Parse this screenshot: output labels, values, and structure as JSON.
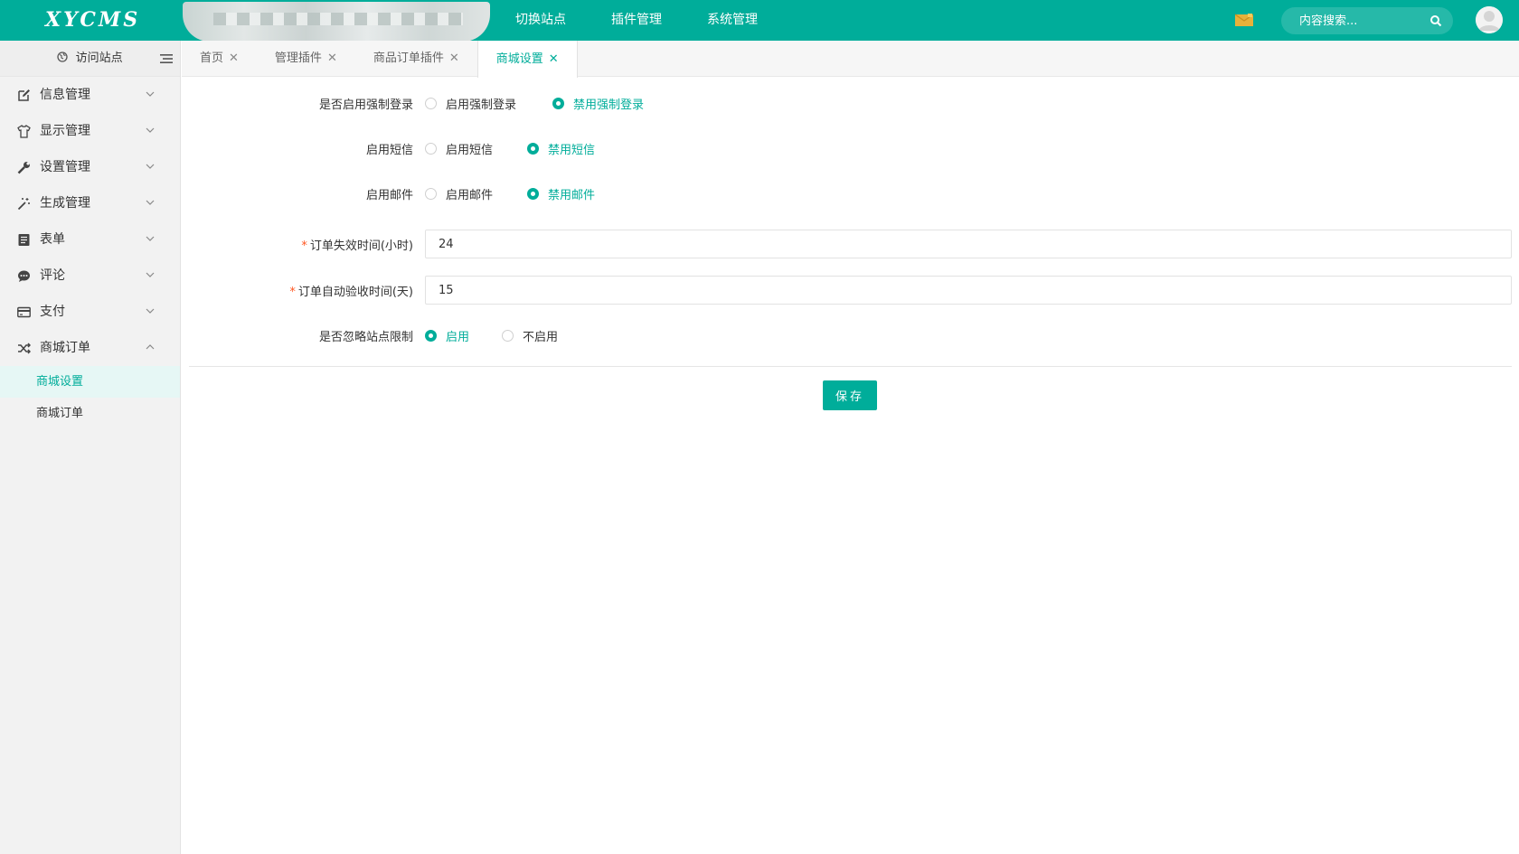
{
  "header": {
    "logo": "XYCMS",
    "nav": [
      "切换站点",
      "插件管理",
      "系统管理"
    ],
    "search_placeholder": "内容搜索..."
  },
  "sidebar": {
    "visit_label": "访问站点",
    "items": [
      {
        "label": "信息管理",
        "icon": "edit-icon"
      },
      {
        "label": "显示管理",
        "icon": "shirt-icon"
      },
      {
        "label": "设置管理",
        "icon": "wrench-icon"
      },
      {
        "label": "生成管理",
        "icon": "magic-wand-icon"
      },
      {
        "label": "表单",
        "icon": "form-icon"
      },
      {
        "label": "评论",
        "icon": "comment-icon"
      },
      {
        "label": "支付",
        "icon": "credit-card-icon"
      },
      {
        "label": "商城订单",
        "icon": "shuffle-icon"
      }
    ],
    "sub_items": [
      "商城设置",
      "商城订单"
    ]
  },
  "tabs": [
    {
      "label": "首页"
    },
    {
      "label": "管理插件"
    },
    {
      "label": "商品订单插件"
    },
    {
      "label": "商城设置",
      "active": true
    }
  ],
  "form": {
    "force_login": {
      "label": "是否启用强制登录",
      "options": [
        "启用强制登录",
        "禁用强制登录"
      ],
      "selected": "禁用强制登录"
    },
    "sms": {
      "label": "启用短信",
      "options": [
        "启用短信",
        "禁用短信"
      ],
      "selected": "禁用短信"
    },
    "email": {
      "label": "启用邮件",
      "options": [
        "启用邮件",
        "禁用邮件"
      ],
      "selected": "禁用邮件"
    },
    "order_expire": {
      "label": "订单失效时间(小时)",
      "value": "24",
      "required_mark": "*"
    },
    "auto_accept": {
      "label": "订单自动验收时间(天)",
      "value": "15",
      "required_mark": "*"
    },
    "ignore_site": {
      "label": "是否忽略站点限制",
      "options": [
        "启用",
        "不启用"
      ],
      "selected": "启用"
    },
    "save_label": "保存"
  },
  "colors": {
    "brand": "#00ad9a",
    "mail_icon": "#e8b13a"
  }
}
